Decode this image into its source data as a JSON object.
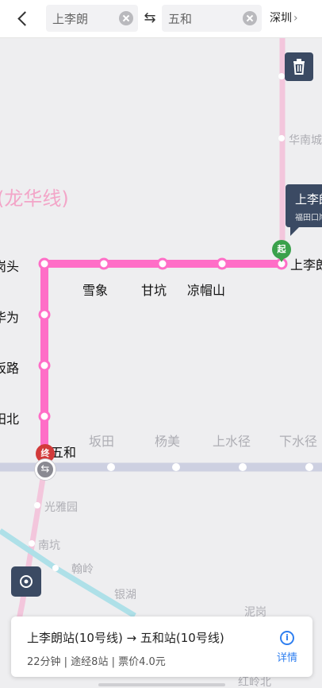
{
  "header": {
    "from_value": "上李朗",
    "to_value": "五和",
    "swap_glyph": "⇆",
    "city": "深圳",
    "city_chevron": "›"
  },
  "map": {
    "line_name": "(龙华线)",
    "route_stations": [
      "雪象",
      "甘坑",
      "凉帽山"
    ],
    "start_station": "上李朗",
    "end_station": "五和",
    "left_station_fragments": [
      "岗头",
      "华为",
      "坂路",
      "田北"
    ],
    "other_line_stations": [
      "坂田",
      "杨美",
      "上水径",
      "下水径"
    ],
    "branch_stations": [
      "光雅园",
      "南坑",
      "翰岭",
      "银湖",
      "华南城"
    ],
    "bottom_faded_labels": [
      "泥岗",
      "红岭北"
    ],
    "start_callout": {
      "title": "上李朗",
      "subtitle": "福田口岸"
    },
    "start_pin_label": "起",
    "end_pin_label": "终",
    "transfer_glyph": "⇆",
    "colors": {
      "route_line": "#ff6ec7",
      "background_line": "#f3c6dc",
      "other_line": "#cdd0e1",
      "branch_line": "#aee0e8"
    }
  },
  "route_card": {
    "route_text": "上李朗站(10号线) → 五和站(10号线)",
    "meta_text": "22分钟 | 途经8站 | 票价4.0元",
    "details_label": "详情",
    "details_icon_glyph": "i"
  },
  "controls": {
    "delete_icon": "trash-icon",
    "locate_icon": "locate-icon"
  }
}
